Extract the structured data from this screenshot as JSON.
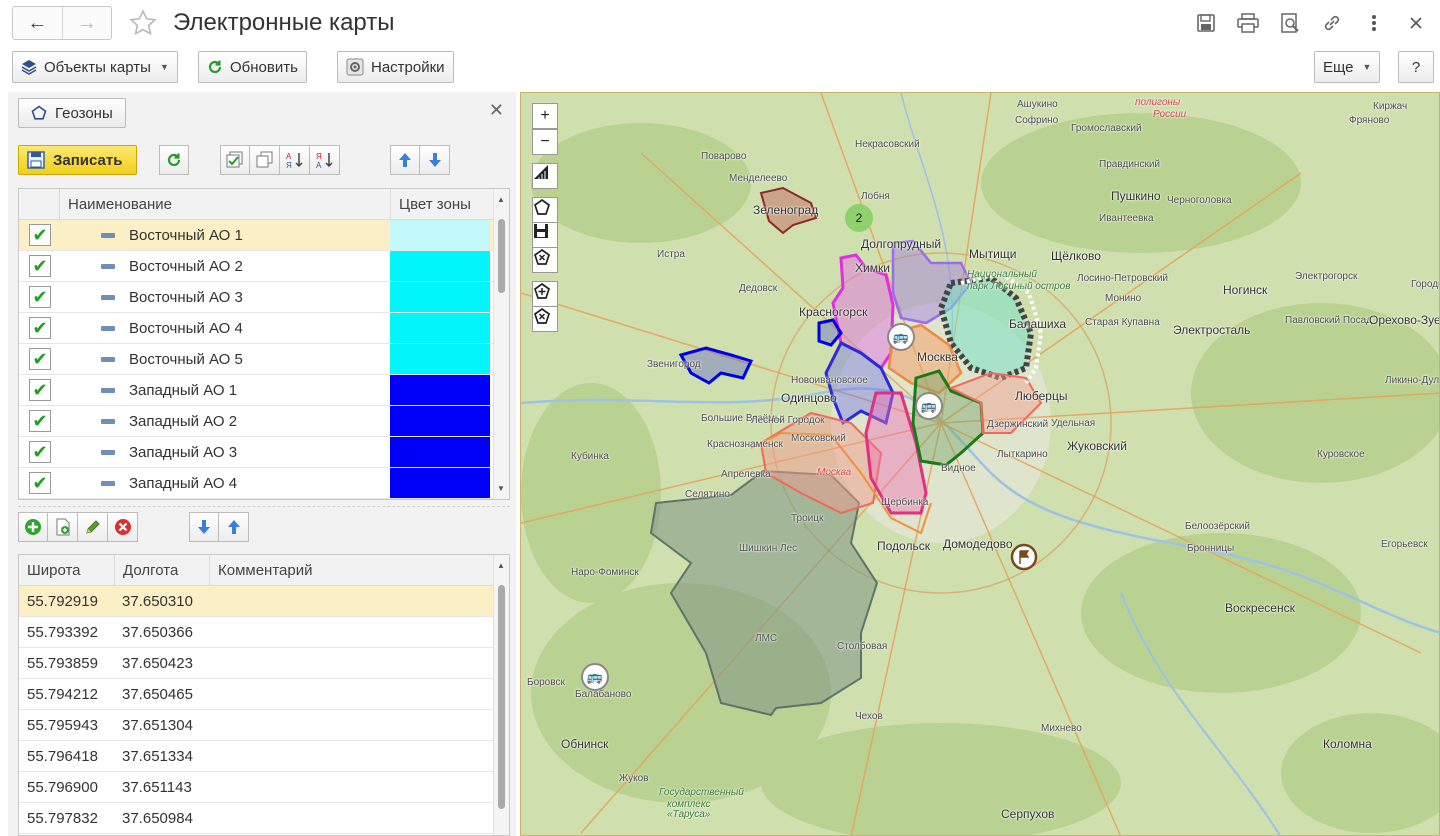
{
  "window": {
    "title": "Электронные карты",
    "nav_back": "←",
    "nav_forward": "→",
    "favorite_icon": "star-icon",
    "tools": [
      "save-icon",
      "print-icon",
      "preview-icon",
      "link-icon",
      "more-vert-icon",
      "close-icon"
    ]
  },
  "toolbar": {
    "map_objects_label": "Объекты карты",
    "refresh_label": "Обновить",
    "settings_label": "Настройки",
    "more_label": "Еще",
    "help_label": "?"
  },
  "geozones": {
    "panel_button_label": "Геозоны",
    "save_label": "Записать",
    "columns": {
      "name": "Наименование",
      "color": "Цвет зоны"
    },
    "rows": [
      {
        "name": "Восточный АО 1",
        "checked": true,
        "color": "#c3f9fb",
        "selected": true
      },
      {
        "name": "Восточный АО 2",
        "checked": true,
        "color": "#00f6f8"
      },
      {
        "name": "Восточный АО 3",
        "checked": true,
        "color": "#00f6f8"
      },
      {
        "name": "Восточный АО 4",
        "checked": true,
        "color": "#00f6f8"
      },
      {
        "name": "Восточный АО 5",
        "checked": true,
        "color": "#00f6f8"
      },
      {
        "name": "Западный АО 1",
        "checked": true,
        "color": "#0000f8"
      },
      {
        "name": "Западный АО 2",
        "checked": true,
        "color": "#0000f8"
      },
      {
        "name": "Западный АО 3",
        "checked": true,
        "color": "#0000f8"
      },
      {
        "name": "Западный АО 4",
        "checked": true,
        "color": "#0000f8"
      }
    ]
  },
  "points": {
    "columns": {
      "lat": "Широта",
      "lon": "Долгота",
      "comment": "Комментарий"
    },
    "rows": [
      {
        "lat": "55.792919",
        "lon": "37.650310",
        "comment": "",
        "selected": true
      },
      {
        "lat": "55.793392",
        "lon": "37.650366",
        "comment": ""
      },
      {
        "lat": "55.793859",
        "lon": "37.650423",
        "comment": ""
      },
      {
        "lat": "55.794212",
        "lon": "37.650465",
        "comment": ""
      },
      {
        "lat": "55.795943",
        "lon": "37.651304",
        "comment": ""
      },
      {
        "lat": "55.796418",
        "lon": "37.651334",
        "comment": ""
      },
      {
        "lat": "55.796900",
        "lon": "37.651143",
        "comment": ""
      },
      {
        "lat": "55.797832",
        "lon": "37.650984",
        "comment": ""
      }
    ]
  },
  "map": {
    "zoom_in": "+",
    "zoom_out": "−",
    "cluster_count": "2",
    "labels": [
      "Ашукино",
      "полигоны",
      "России",
      "Киржач",
      "Софрино",
      "Громославский",
      "Фряново",
      "Некрасовский",
      "Поварово",
      "Правдинский",
      "Менделеево",
      "Лобня",
      "Пушкино",
      "Зеленоград",
      "Ивантеевка",
      "Черноголовка",
      "Долгопрудный",
      "Мытищи",
      "Щёлково",
      "Истра",
      "Химки",
      "Лосино-Петровский",
      "Электрогорск",
      "Дедовск",
      "Национальный",
      "парк Лосиный остров",
      "Ногинск",
      "Городищи",
      "Монино",
      "Красногорск",
      "Балашиха",
      "Старая Купавна",
      "Электросталь",
      "Павловский Посад",
      "Орехово-Зуево",
      "Москва",
      "Звенигород",
      "Новоивановское",
      "Одинцово",
      "Ликино-Дулёво",
      "Люберцы",
      "Большие Вязёмы",
      "Лесной Городок",
      "Дзержинский",
      "Удельная",
      "Жуковский",
      "Краснознаменск",
      "Московский",
      "Кубинка",
      "Лыткарино",
      "Куровское",
      "Апрелевка",
      "Москва",
      "Видное",
      "Селятино",
      "Щербинка",
      "Белоозёрский",
      "Троицк",
      "Подольск",
      "Домодедово",
      "Бронницы",
      "Шишкин Лес",
      "Наро-Фоминск",
      "Егорьевск",
      "Воскресенск",
      "ЛМС",
      "Столбовая",
      "Боровск",
      "Балабаново",
      "Чехов",
      "Михнево",
      "Коломна",
      "Обнинск",
      "Жуков",
      "Государственный",
      "комплекс",
      "«Таруса»",
      "Серпухов"
    ]
  }
}
